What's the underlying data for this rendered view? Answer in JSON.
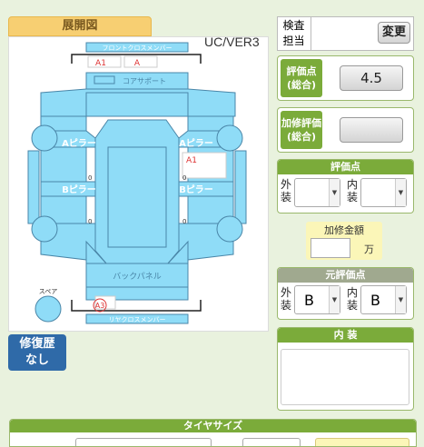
{
  "diagram": {
    "tab_title": "展開図",
    "version": "UC/VER3",
    "labels": {
      "front_cross": "フロントクロスメンバー",
      "core_support": "コアサポート",
      "a_pillar_left": "Aピラー",
      "a_pillar_right": "Aピラー",
      "b_pillar_left": "Bピラー",
      "b_pillar_right": "Bピラー",
      "back_panel": "バックパネル",
      "rear_cross": "リヤクロスメンバー",
      "spare": "スペア"
    },
    "marks": [
      {
        "code": "A1",
        "area": "front_cross_left"
      },
      {
        "code": "A",
        "area": "front_cross_right"
      },
      {
        "code": "A1",
        "area": "right_side"
      },
      {
        "code": "A3",
        "area": "rear_cross"
      }
    ],
    "zero_marks": [
      "0",
      "0",
      "0",
      "0"
    ]
  },
  "inspector": {
    "label": "検査\n担当",
    "change_button": "変更"
  },
  "score_total": {
    "label": "評価点\n(総合)",
    "value": "4.5"
  },
  "repair_eval": {
    "label": "加修評価\n(総合)",
    "value": ""
  },
  "evaluation": {
    "title": "評価点",
    "exterior_label": "外\n装",
    "interior_label": "内\n装",
    "exterior_value": "",
    "interior_value": ""
  },
  "repair_amount": {
    "title": "加修金額",
    "value": "",
    "unit": "万"
  },
  "original_eval": {
    "title": "元評価点",
    "exterior_label": "外\n装",
    "interior_label": "内\n装",
    "exterior_value": "B",
    "interior_value": "B"
  },
  "repair_history": {
    "label": "修復歴\nなし"
  },
  "interior_notes": {
    "title": "内 装",
    "value": ""
  },
  "tire": {
    "title": "タイヤサイズ"
  }
}
